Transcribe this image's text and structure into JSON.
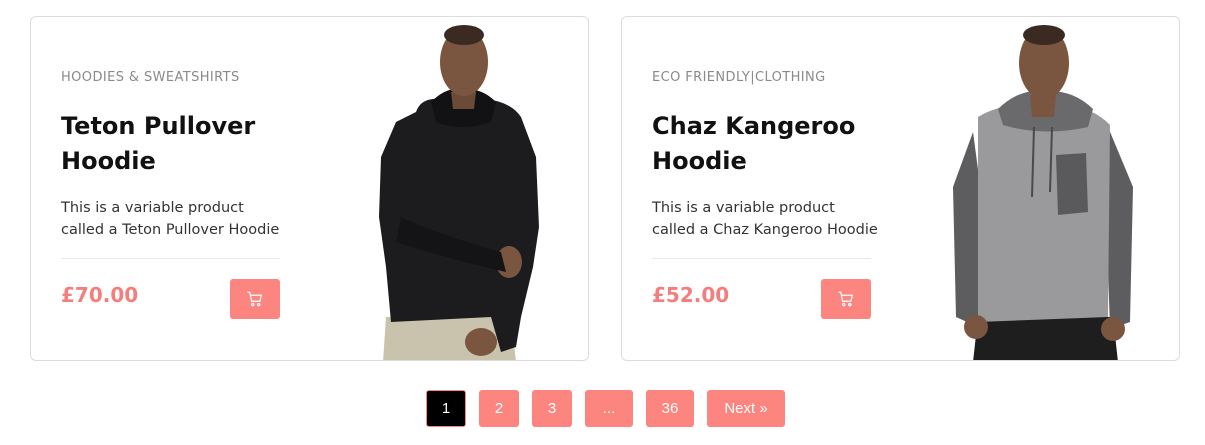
{
  "products": [
    {
      "category": "HOODIES & SWEATSHIRTS",
      "title": "Teton Pullover Hoodie",
      "description": "This is a variable product called a Teton Pullover Hoodie",
      "price": "£70.00",
      "cart_icon": "cart-icon",
      "image_icon": "model-black-hoodie"
    },
    {
      "category": "ECO FRIENDLY|CLOTHING",
      "title": "Chaz Kangeroo Hoodie",
      "description": "This is a variable product called a Chaz Kangeroo Hoodie",
      "price": "£52.00",
      "cart_icon": "cart-icon",
      "image_icon": "model-grey-hoodie"
    }
  ],
  "pagination": {
    "pages": [
      "1",
      "2",
      "3",
      "...",
      "36"
    ],
    "current": "1",
    "next_label": "Next »"
  },
  "colors": {
    "accent": "#fd8580",
    "price": "#f47e7b",
    "active_page": "#000000"
  }
}
